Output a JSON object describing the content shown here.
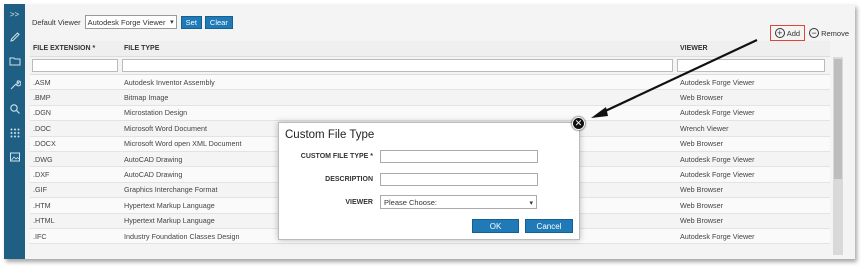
{
  "nav": {
    "collapse_label": ">>",
    "icons": [
      "pencil-icon",
      "folder-icon",
      "wrench-icon",
      "search-icon",
      "grid-dots-icon",
      "image-icon"
    ]
  },
  "toolbar": {
    "default_viewer_label": "Default Viewer",
    "default_viewer_value": "Autodesk Forge Viewer",
    "set_label": "Set",
    "clear_label": "Clear"
  },
  "actions": {
    "add_label": "Add",
    "remove_label": "Remove"
  },
  "table": {
    "headers": {
      "file_extension": "FILE EXTENSION *",
      "file_type": "FILE TYPE",
      "viewer": "VIEWER"
    },
    "rows": [
      {
        "ext": ".ASM",
        "type": "Autodesk Inventor Assembly",
        "viewer": "Autodesk Forge Viewer"
      },
      {
        "ext": ".BMP",
        "type": "Bitmap Image",
        "viewer": "Web Browser"
      },
      {
        "ext": ".DGN",
        "type": "Microstation Design",
        "viewer": "Autodesk Forge Viewer"
      },
      {
        "ext": ".DOC",
        "type": "Microsoft Word Document",
        "viewer": "Wrench Viewer"
      },
      {
        "ext": ".DOCX",
        "type": "Microsoft Word open XML Document",
        "viewer": "Web Browser"
      },
      {
        "ext": ".DWG",
        "type": "AutoCAD Drawing",
        "viewer": "Autodesk Forge Viewer"
      },
      {
        "ext": ".DXF",
        "type": "AutoCAD Drawing",
        "viewer": "Autodesk Forge Viewer"
      },
      {
        "ext": ".GIF",
        "type": "Graphics Interchange Format",
        "viewer": "Web Browser"
      },
      {
        "ext": ".HTM",
        "type": "Hypertext Markup Language",
        "viewer": "Web Browser"
      },
      {
        "ext": ".HTML",
        "type": "Hypertext Markup Language",
        "viewer": "Web Browser"
      },
      {
        "ext": ".IFC",
        "type": "Industry Foundation Classes Design",
        "viewer": "Autodesk Forge Viewer"
      }
    ]
  },
  "modal": {
    "title": "Custom File Type",
    "custom_file_type_label": "CUSTOM FILE TYPE *",
    "description_label": "DESCRIPTION",
    "viewer_label": "VIEWER",
    "viewer_value": "Please Choose:",
    "ok_label": "OK",
    "cancel_label": "Cancel",
    "close_icon": "close-icon"
  },
  "colors": {
    "nav_bg": "#1e5f83",
    "button_blue": "#1f7ab7",
    "highlight_red": "#e0453a"
  }
}
